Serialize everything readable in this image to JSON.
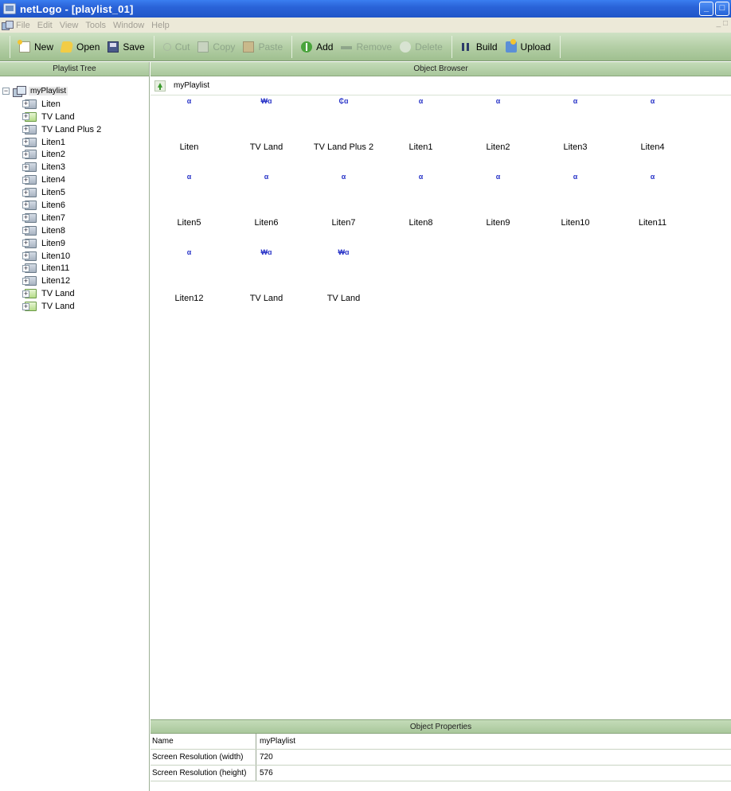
{
  "window": {
    "title": "netLogo - [playlist_01]",
    "controls": [
      "_",
      "□"
    ]
  },
  "menu": {
    "items": [
      "File",
      "Edit",
      "View",
      "Tools",
      "Window",
      "Help"
    ],
    "mdi_controls": "_ □"
  },
  "toolbar": {
    "new": "New",
    "open": "Open",
    "save": "Save",
    "cut": "Cut",
    "copy": "Copy",
    "paste": "Paste",
    "add": "Add",
    "remove": "Remove",
    "delete": "Delete",
    "build": "Build",
    "upload": "Upload"
  },
  "playlist_tree": {
    "header": "Playlist Tree",
    "root": "myPlaylist",
    "items": [
      {
        "label": "Liten",
        "type": "item"
      },
      {
        "label": "TV Land",
        "type": "tv"
      },
      {
        "label": "TV Land Plus 2",
        "type": "item"
      },
      {
        "label": "Liten1",
        "type": "item"
      },
      {
        "label": "Liten2",
        "type": "item"
      },
      {
        "label": "Liten3",
        "type": "item"
      },
      {
        "label": "Liten4",
        "type": "item"
      },
      {
        "label": "Liten5",
        "type": "item"
      },
      {
        "label": "Liten6",
        "type": "item"
      },
      {
        "label": "Liten7",
        "type": "item"
      },
      {
        "label": "Liten8",
        "type": "item"
      },
      {
        "label": "Liten9",
        "type": "item"
      },
      {
        "label": "Liten10",
        "type": "item"
      },
      {
        "label": "Liten11",
        "type": "item"
      },
      {
        "label": "Liten12",
        "type": "item"
      },
      {
        "label": "TV Land",
        "type": "tv"
      },
      {
        "label": "TV Land",
        "type": "tv"
      }
    ]
  },
  "object_browser": {
    "header": "Object Browser",
    "path": "myPlaylist",
    "objects": [
      {
        "label": "Liten",
        "thumb": "α"
      },
      {
        "label": "TV Land",
        "thumb": "₩ɑ"
      },
      {
        "label": "TV Land Plus 2",
        "thumb": "₵ɑ"
      },
      {
        "label": "Liten1",
        "thumb": "α"
      },
      {
        "label": "Liten2",
        "thumb": "α"
      },
      {
        "label": "Liten3",
        "thumb": "α"
      },
      {
        "label": "Liten4",
        "thumb": "α"
      },
      {
        "label": "Liten5",
        "thumb": "α"
      },
      {
        "label": "Liten6",
        "thumb": "α"
      },
      {
        "label": "Liten7",
        "thumb": "α"
      },
      {
        "label": "Liten8",
        "thumb": "α"
      },
      {
        "label": "Liten9",
        "thumb": "α"
      },
      {
        "label": "Liten10",
        "thumb": "α"
      },
      {
        "label": "Liten11",
        "thumb": "α"
      },
      {
        "label": "Liten12",
        "thumb": "α"
      },
      {
        "label": "TV Land",
        "thumb": "₩ɑ"
      },
      {
        "label": "TV Land",
        "thumb": "₩ɑ"
      }
    ]
  },
  "object_properties": {
    "header": "Object Properties",
    "rows": [
      {
        "name": "Name",
        "value": "myPlaylist"
      },
      {
        "name": "Screen Resolution (width)",
        "value": "720"
      },
      {
        "name": "Screen Resolution (height)",
        "value": "576"
      }
    ]
  },
  "colors": {
    "titlebar": "#2a63d8",
    "toolbar": "#b4cfa6",
    "pane_header": "#b7d2aa",
    "thumb_text": "#2a35c8"
  }
}
